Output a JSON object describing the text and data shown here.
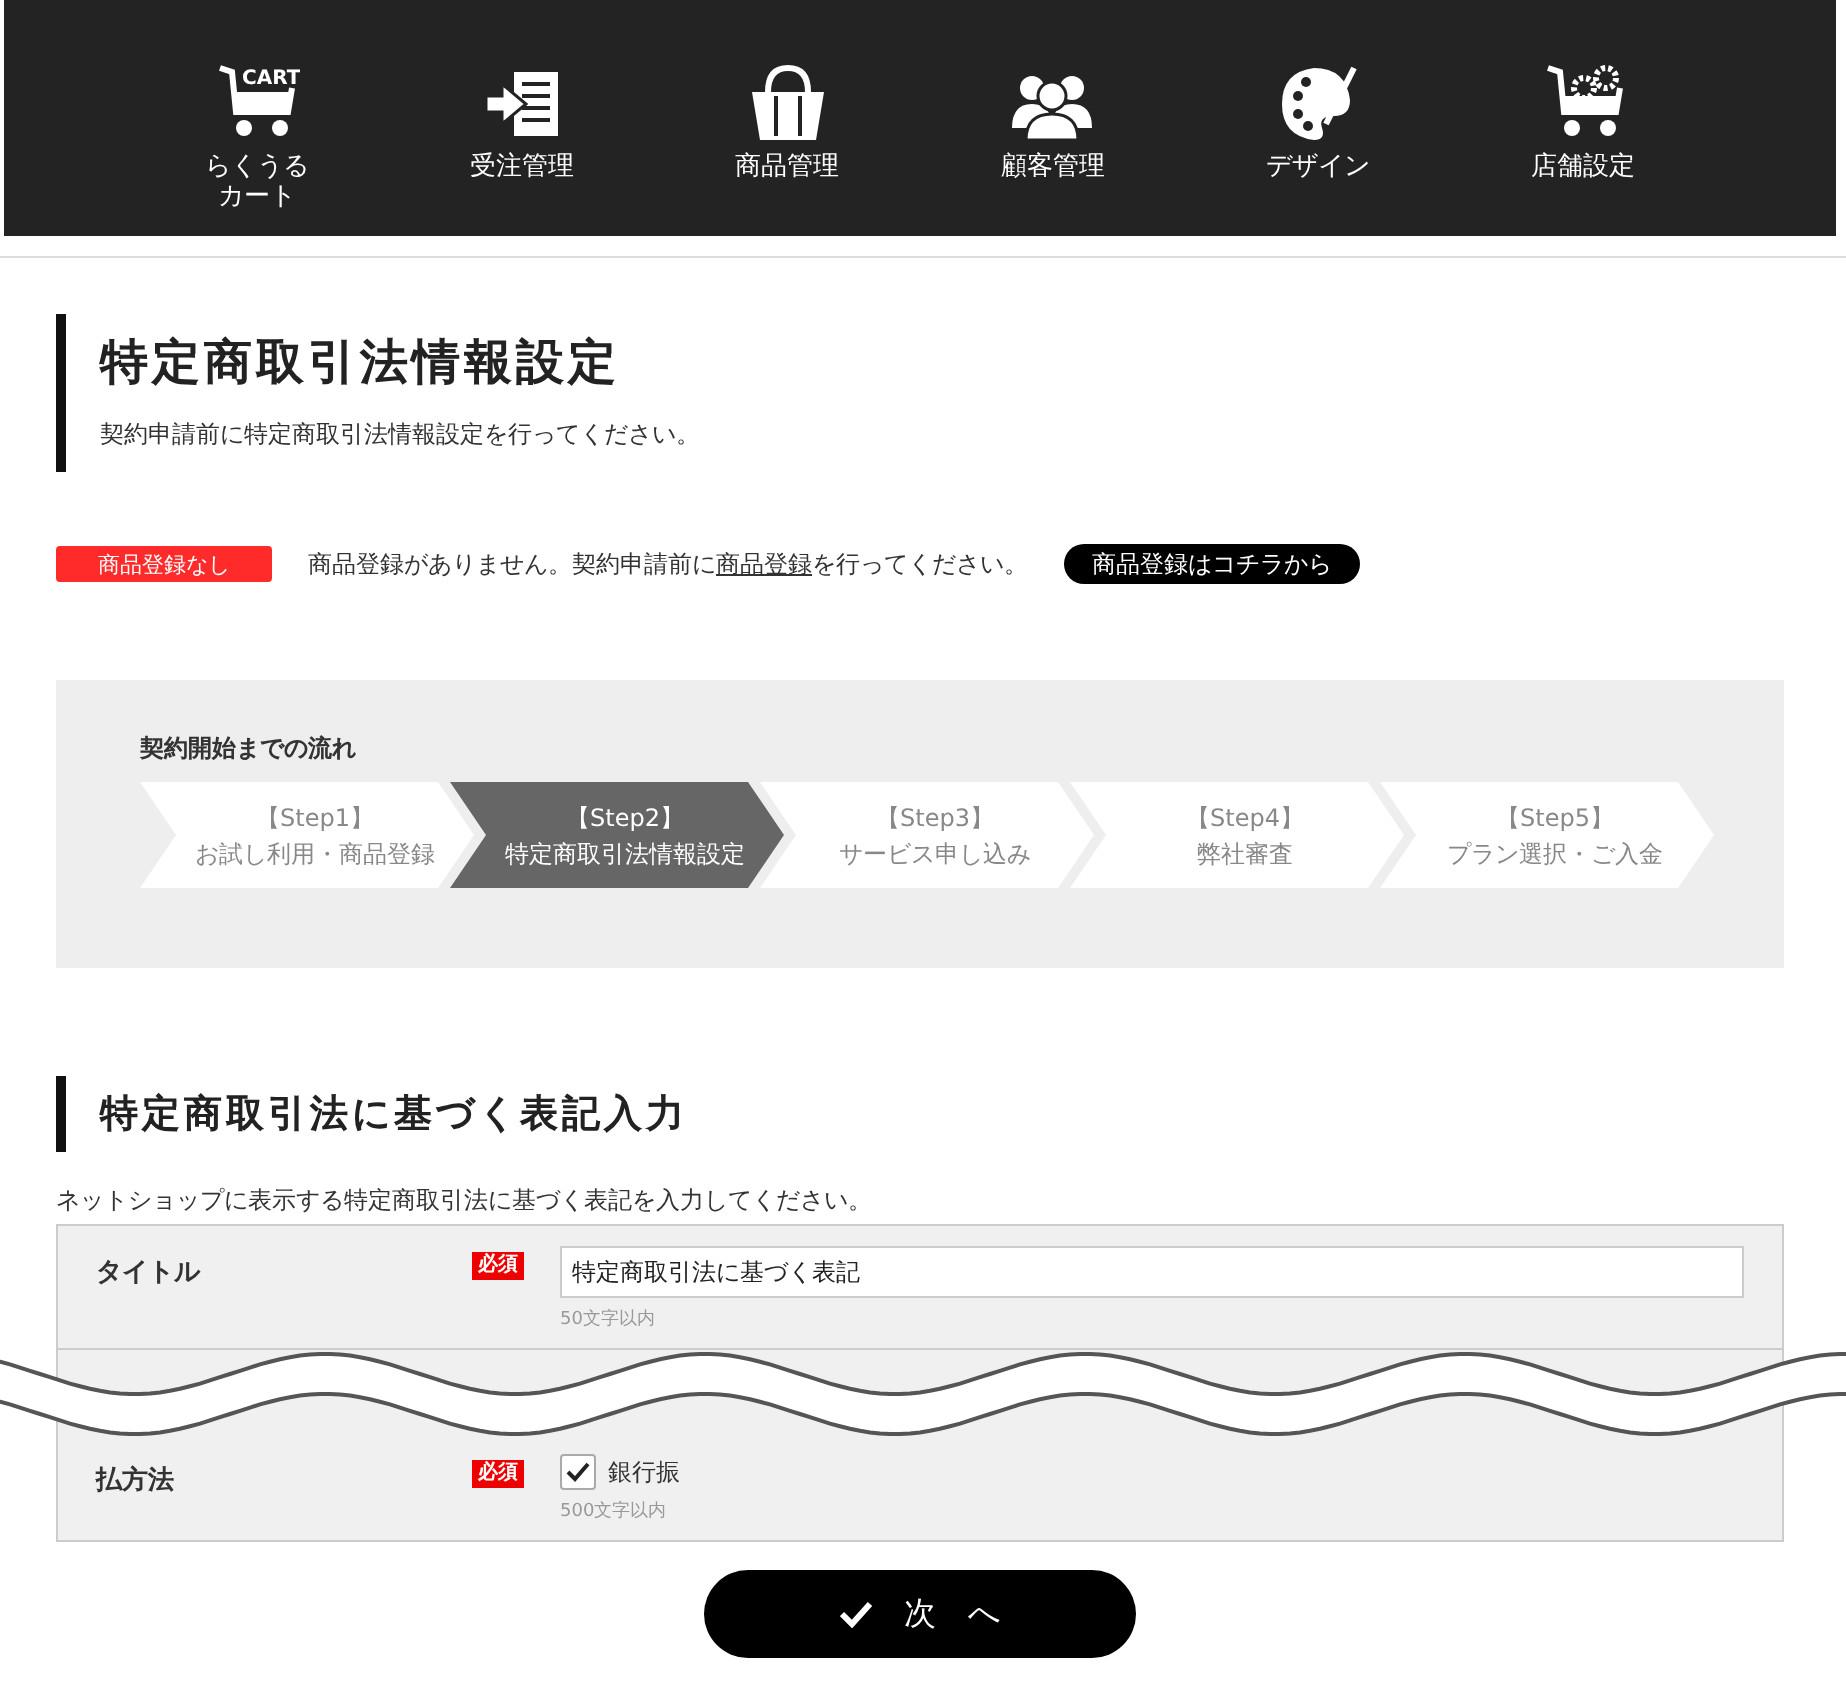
{
  "nav": [
    {
      "kind": "cart",
      "label": [
        "らくうる",
        "カート"
      ]
    },
    {
      "kind": "order",
      "label": [
        "受注管理"
      ]
    },
    {
      "kind": "bag",
      "label": [
        "商品管理"
      ]
    },
    {
      "kind": "users",
      "label": [
        "顧客管理"
      ]
    },
    {
      "kind": "palette",
      "label": [
        "デザイン"
      ]
    },
    {
      "kind": "shop",
      "label": [
        "店舗設定"
      ]
    }
  ],
  "cart_logo_text": "CART",
  "page": {
    "title": "特定商取引法情報設定",
    "subtitle": "契約申請前に特定商取引法情報設定を行ってください。"
  },
  "notice": {
    "badge": "商品登録なし",
    "message_before": "商品登録がありません。契約申請前に",
    "link": "商品登録",
    "message_after": "を行ってください。",
    "button": "商品登録はコチラから"
  },
  "flow": {
    "title": "契約開始までの流れ",
    "steps": [
      {
        "step": "【Step1】",
        "label": "お試し利用・商品登録",
        "selected": false
      },
      {
        "step": "【Step2】",
        "label": "特定商取引法情報設定",
        "selected": true
      },
      {
        "step": "【Step3】",
        "label": "サービス申し込み",
        "selected": false
      },
      {
        "step": "【Step4】",
        "label": "弊社審査",
        "selected": false
      },
      {
        "step": "【Step5】",
        "label": "プラン選択・ご入金",
        "selected": false
      }
    ]
  },
  "section": {
    "title": "特定商取引法に基づく表記入力",
    "description": "ネットショップに表示する特定商取引法に基づく表記を入力してください。"
  },
  "form": [
    {
      "kind": "text",
      "label": "タイトル",
      "required": true,
      "required_label": "必須",
      "value": "特定商取引法に基づく表記",
      "hint": "50文字以内"
    },
    {
      "kind": "checkbox",
      "label": "払方法",
      "required": true,
      "required_label": "必須",
      "checked": true,
      "option": "銀行振",
      "hint": "500文字以内"
    }
  ],
  "next_button": "次　へ"
}
